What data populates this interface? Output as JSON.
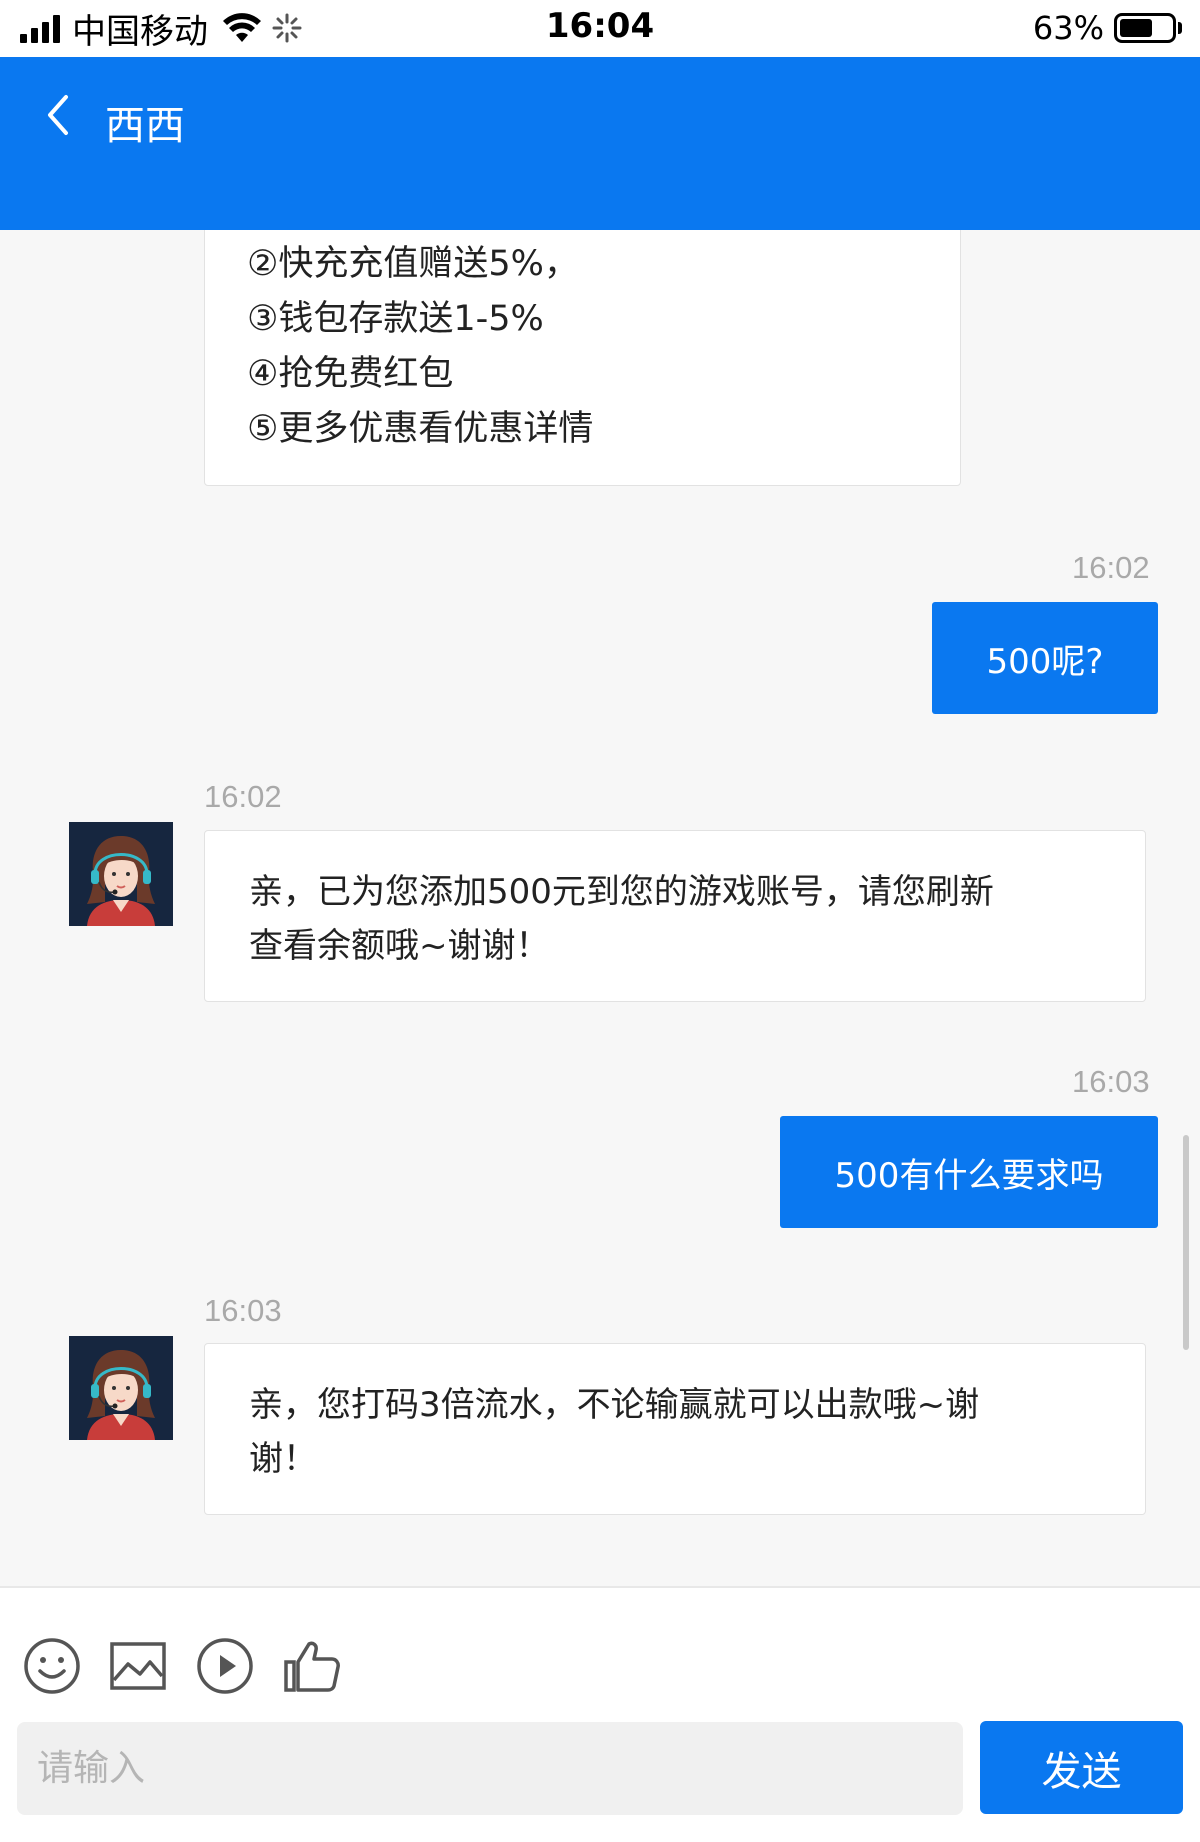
{
  "status_bar": {
    "carrier": "中国移动",
    "time": "16:04",
    "battery": "63%",
    "battery_level": 0.63
  },
  "header": {
    "title": "西西",
    "back_icon": "chevron-left-icon"
  },
  "messages": {
    "promo_lines": [
      "②快充充值赠送5%，",
      "③钱包存款送1-5%",
      "④抢免费红包",
      "⑤更多优惠看优惠详情"
    ],
    "m1": {
      "time": "16:02",
      "text": "500呢?"
    },
    "m2": {
      "time": "16:02",
      "line1": "亲，已为您添加500元到您的游戏账号，请您刷新",
      "line2": "查看余额哦~谢谢！"
    },
    "m3": {
      "time": "16:03",
      "text": "500有什么要求吗"
    },
    "m4": {
      "time": "16:03",
      "line1": "亲，您打码3倍流水，不论输赢就可以出款哦~谢",
      "line2": "谢！"
    }
  },
  "composer": {
    "placeholder": "请输入",
    "send_label": "发送",
    "icons": [
      "smiley-icon",
      "image-icon",
      "play-icon",
      "thumbs-up-icon"
    ]
  },
  "colors": {
    "brand": "#0a78f0",
    "background": "#f7f7f7"
  }
}
